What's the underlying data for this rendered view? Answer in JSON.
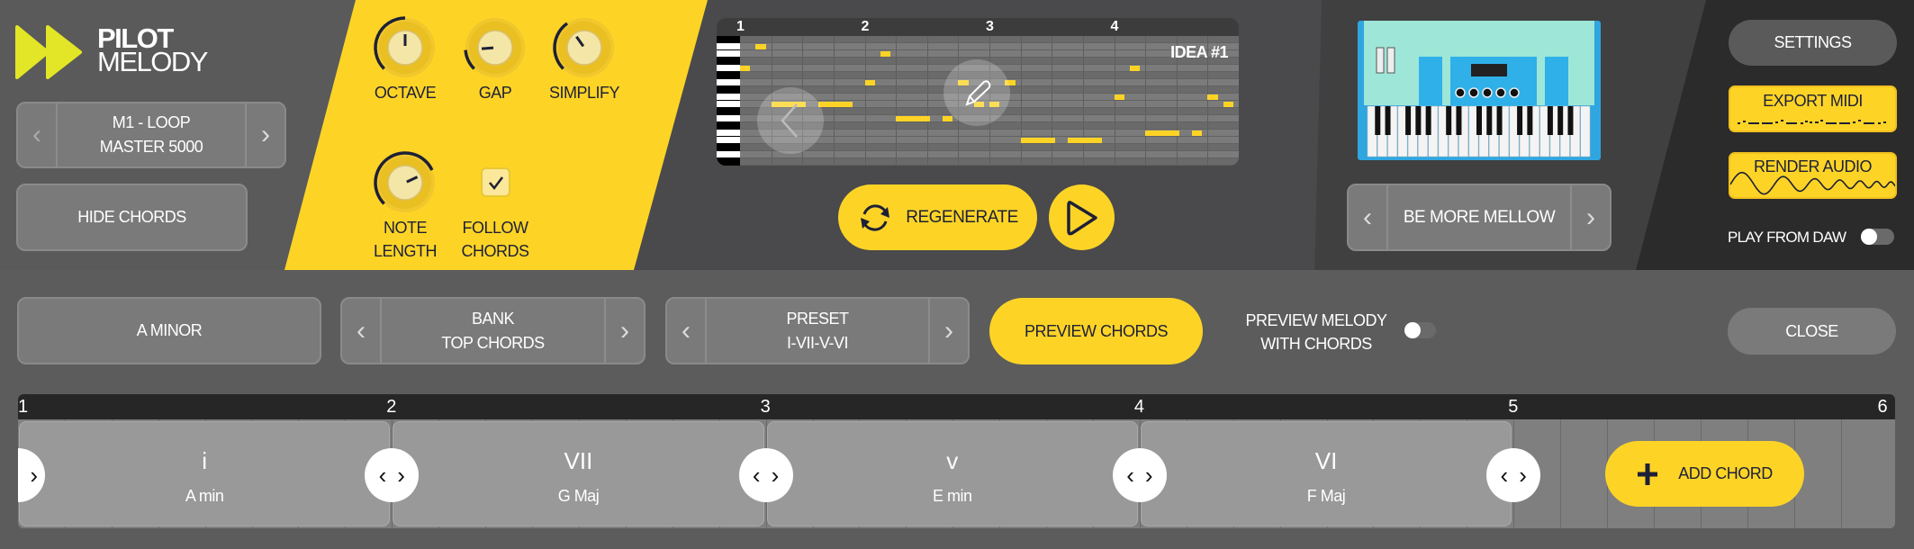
{
  "colors": {
    "accent": "#fdd426",
    "logo": "#e2e626",
    "dark_text": "#1e2036",
    "panel_left": "#5a5a5a",
    "panel_mid": "#4a4a4c",
    "panel_right": "#404040",
    "panel_far": "#2b2b2b",
    "synth_body": "#9ee6d8",
    "synth_frame": "#2fa6e0"
  },
  "logo": {
    "line1": "PILOT",
    "line2": "MELODY",
    "icon": "fast-forward-icon"
  },
  "model_selector": {
    "line1": "M1 - LOOP",
    "line2": "MASTER 5000",
    "prev_icon": "chevron-left-icon",
    "next_icon": "chevron-right-icon"
  },
  "hide_chords_label": "HIDE CHORDS",
  "knobs": [
    {
      "label": "OCTAVE",
      "value": 0.5
    },
    {
      "label": "GAP",
      "value": 0.15
    },
    {
      "label": "SIMPLIFY",
      "value": 0.37
    },
    {
      "label_line1": "NOTE",
      "label_line2": "LENGTH",
      "value": 0.74
    }
  ],
  "follow_chords": {
    "line1": "FOLLOW",
    "line2": "CHORDS",
    "checked": true
  },
  "piano_roll": {
    "bars": [
      "1",
      "2",
      "3",
      "4"
    ],
    "idea_label": "IDEA #1",
    "notes": [
      {
        "row": 1,
        "start": 0.5,
        "len": 0.33
      },
      {
        "row": 2,
        "start": 4.5,
        "len": 0.33
      },
      {
        "row": 4,
        "start": 0,
        "len": 0.33
      },
      {
        "row": 4,
        "start": 12.5,
        "len": 0.33
      },
      {
        "row": 6,
        "start": 4,
        "len": 0.33
      },
      {
        "row": 6,
        "start": 7,
        "len": 0.33
      },
      {
        "row": 6,
        "start": 8.5,
        "len": 0.33
      },
      {
        "row": 8,
        "start": 12,
        "len": 0.33
      },
      {
        "row": 8,
        "start": 15,
        "len": 0.33
      },
      {
        "row": 9,
        "start": 1,
        "len": 1.1
      },
      {
        "row": 9,
        "start": 2.5,
        "len": 1.1
      },
      {
        "row": 9,
        "start": 7.5,
        "len": 0.33
      },
      {
        "row": 9,
        "start": 8,
        "len": 0.33
      },
      {
        "row": 9,
        "start": 15.5,
        "len": 0.33
      },
      {
        "row": 11,
        "start": 5,
        "len": 1.1
      },
      {
        "row": 11,
        "start": 6.5,
        "len": 0.33
      },
      {
        "row": 13,
        "start": 13,
        "len": 1.1
      },
      {
        "row": 13,
        "start": 14.5,
        "len": 0.33
      },
      {
        "row": 14,
        "start": 9,
        "len": 1.1
      },
      {
        "row": 14,
        "start": 10.5,
        "len": 1.1
      }
    ]
  },
  "regenerate_label": "REGENERATE",
  "instrument": {
    "preset": "BE MORE MELLOW"
  },
  "settings_label": "SETTINGS",
  "export_midi_label": "EXPORT MIDI",
  "render_audio_label": "RENDER AUDIO",
  "play_from_daw": {
    "label": "PLAY FROM DAW",
    "on": false
  },
  "key_label": "A MINOR",
  "bank": {
    "line1": "BANK",
    "line2": "TOP CHORDS"
  },
  "preset": {
    "line1": "PRESET",
    "line2": "I-VII-V-VI"
  },
  "preview_chords_label": "PREVIEW CHORDS",
  "preview_melody": {
    "line1": "PREVIEW MELODY",
    "line2": "WITH CHORDS",
    "on": false
  },
  "close_label": "CLOSE",
  "timeline": {
    "bars": [
      "1",
      "2",
      "3",
      "4",
      "5",
      "6"
    ],
    "chords": [
      {
        "numeral": "i",
        "name": "A min"
      },
      {
        "numeral": "VII",
        "name": "G Maj"
      },
      {
        "numeral": "v",
        "name": "E min"
      },
      {
        "numeral": "VI",
        "name": "F Maj"
      }
    ],
    "add_chord_label": "ADD CHORD"
  }
}
